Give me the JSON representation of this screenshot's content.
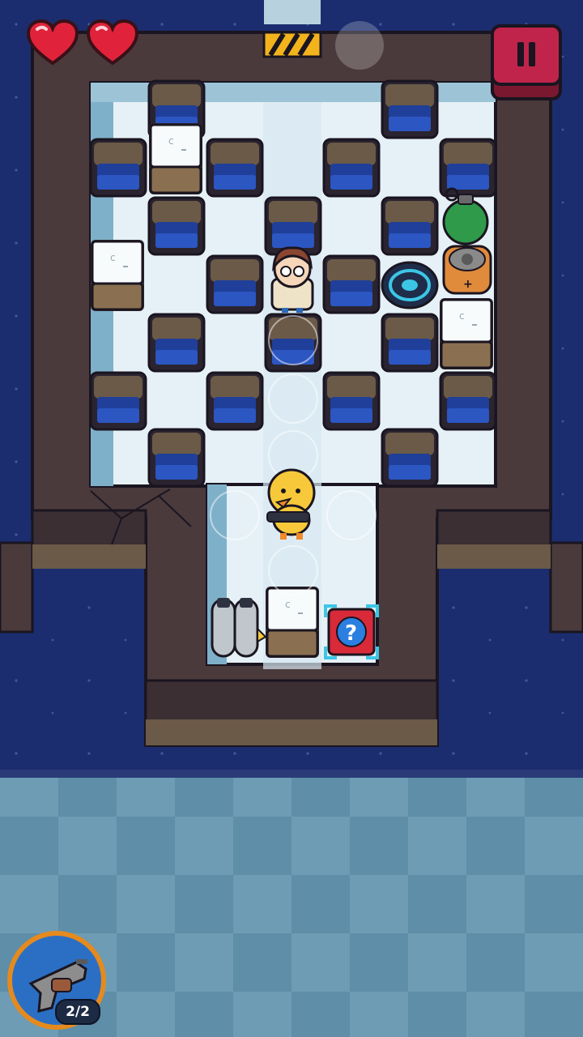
{
  "hud": {
    "hearts": [
      {
        "icon": "heart-full-icon",
        "state": "full"
      },
      {
        "icon": "heart-full-icon",
        "state": "full"
      }
    ],
    "pause_icon": "pause-icon",
    "weapon": {
      "icon": "revolver-icon",
      "ammo_label": "2/2"
    }
  },
  "board": {
    "enemy": "scientist-enemy",
    "player": "duck-with-gun",
    "pickups": [
      "green-grenade-icon",
      "battery-icon",
      "teleport-pad-icon",
      "mystery-crate-icon",
      "jetpack-icon"
    ],
    "colors": {
      "water": "#1b2d6e",
      "floor_light": "#e6f1f7",
      "floor_tile": "#cfe3ee",
      "wall": "#4a3a3c",
      "ice_light": "#5e8ea8",
      "accent_red": "#c0244a"
    }
  }
}
